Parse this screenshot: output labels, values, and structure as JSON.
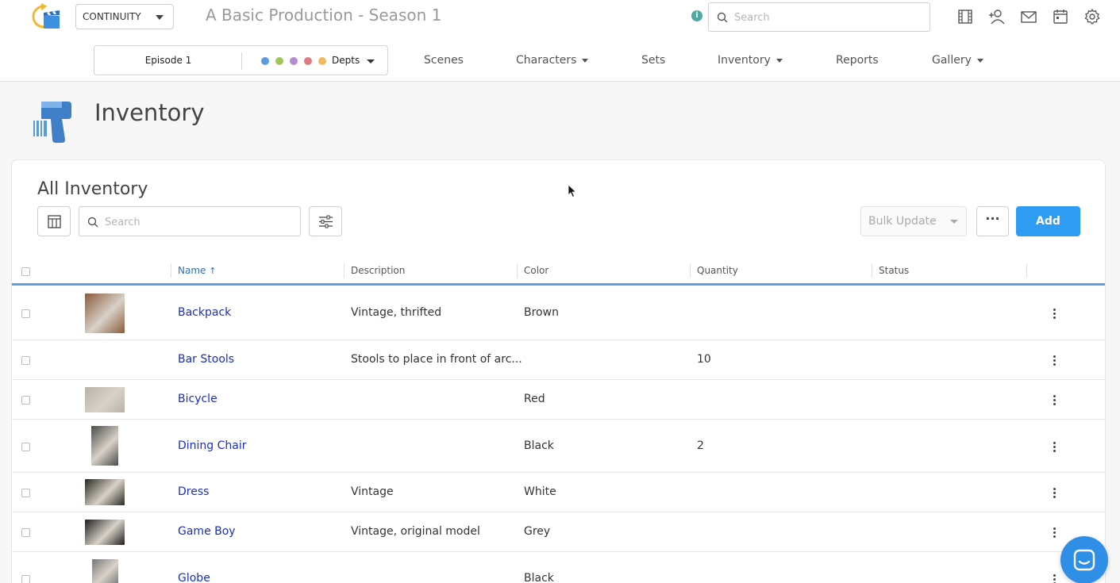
{
  "topbar": {
    "module": "CONTINUITY",
    "production_title": "A Basic Production - Season 1",
    "info": "i",
    "search_placeholder": "Search",
    "icons": [
      "film-icon",
      "add-user-icon",
      "mail-icon",
      "calendar-icon",
      "gear-icon"
    ]
  },
  "nav": {
    "episode": "Episode 1",
    "dept_colors": [
      "#5b9bdb",
      "#a3c55a",
      "#b58bd2",
      "#e07b80",
      "#f0b960"
    ],
    "dept_label": "Depts",
    "items": [
      {
        "label": "Scenes",
        "dropdown": false
      },
      {
        "label": "Characters",
        "dropdown": true
      },
      {
        "label": "Sets",
        "dropdown": false
      },
      {
        "label": "Inventory",
        "dropdown": true
      },
      {
        "label": "Reports",
        "dropdown": false
      },
      {
        "label": "Gallery",
        "dropdown": true
      }
    ]
  },
  "page": {
    "title": "Inventory"
  },
  "card": {
    "title": "All Inventory",
    "search_placeholder": "Search",
    "bulk_update": "Bulk Update",
    "more": "···",
    "add": "Add"
  },
  "table": {
    "columns": [
      "Name",
      "Description",
      "Color",
      "Quantity",
      "Status"
    ],
    "sort_indicator": "↑",
    "rows": [
      {
        "name": "Backpack",
        "description": "Vintage, thrifted",
        "color": "Brown",
        "quantity": "",
        "status": "",
        "thumb": "#8a5a3a"
      },
      {
        "name": "Bar Stools",
        "description": "Stools to place in front of arc...",
        "color": "",
        "quantity": "10",
        "status": "",
        "thumb": ""
      },
      {
        "name": "Bicycle",
        "description": "",
        "color": "Red",
        "quantity": "",
        "status": "",
        "thumb": "#b9b2a8"
      },
      {
        "name": "Dining Chair",
        "description": "",
        "color": "Black",
        "quantity": "2",
        "status": "",
        "thumb": "#4a4a48"
      },
      {
        "name": "Dress",
        "description": "Vintage",
        "color": "White",
        "quantity": "",
        "status": "",
        "thumb": "#2a2a22"
      },
      {
        "name": "Game Boy",
        "description": "Vintage, original model",
        "color": "Grey",
        "quantity": "",
        "status": "",
        "thumb": "#1e1e1e"
      },
      {
        "name": "Globe",
        "description": "",
        "color": "Black",
        "quantity": "",
        "status": "",
        "thumb": "#777777"
      }
    ]
  },
  "colors": {
    "accent": "#2f9cf4",
    "link": "#1a2fbf",
    "header_rule": "#5d9fe3"
  }
}
